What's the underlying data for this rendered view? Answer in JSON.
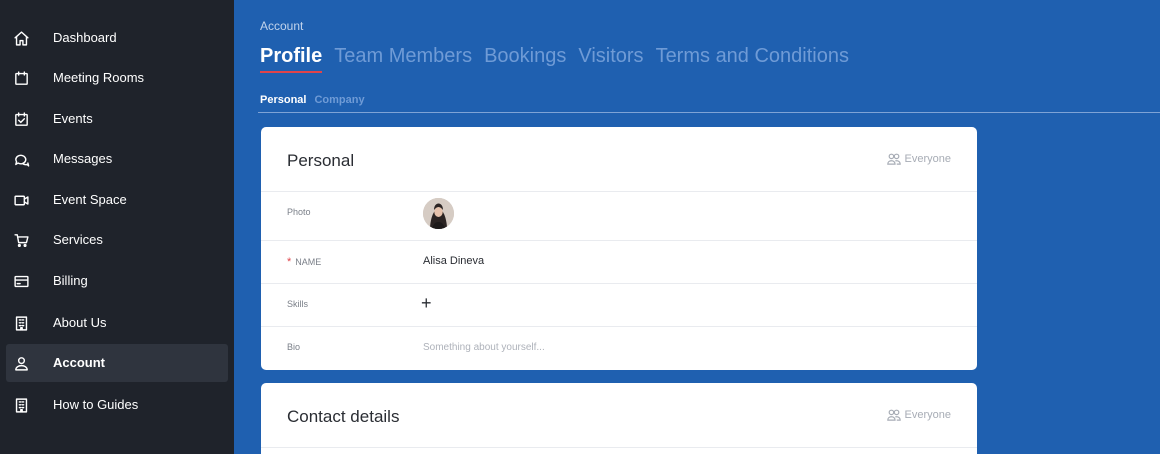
{
  "sidebar": {
    "items": [
      {
        "label": "Dashboard",
        "icon": "home-icon"
      },
      {
        "label": "Meeting Rooms",
        "icon": "calendar-icon"
      },
      {
        "label": "Events",
        "icon": "calendar-check-icon"
      },
      {
        "label": "Messages",
        "icon": "chat-icon"
      },
      {
        "label": "Event Space",
        "icon": "video-icon"
      },
      {
        "label": "Services",
        "icon": "cart-icon"
      },
      {
        "label": "Billing",
        "icon": "credit-card-icon"
      },
      {
        "label": "About Us",
        "icon": "building-icon"
      },
      {
        "label": "Account",
        "icon": "user-icon",
        "active": true
      },
      {
        "label": "How to Guides",
        "icon": "building-icon"
      }
    ]
  },
  "header": {
    "breadcrumb": "Account",
    "tabs": [
      "Profile",
      "Team Members",
      "Bookings",
      "Visitors",
      "Terms and Conditions"
    ],
    "active_tab": "Profile",
    "subtabs": [
      "Personal",
      "Company"
    ],
    "active_subtab": "Personal"
  },
  "personal_card": {
    "title": "Personal",
    "audience": "Everyone",
    "rows": {
      "photo_label": "Photo",
      "name_label": "NAME",
      "name_required_mark": "*",
      "name_value": "Alisa Dineva",
      "skills_label": "Skills",
      "skills_add": "+",
      "bio_label": "Bio",
      "bio_placeholder": "Something about yourself..."
    }
  },
  "contact_card": {
    "title": "Contact details",
    "audience": "Everyone"
  },
  "colors": {
    "sidebar_bg": "#1f232b",
    "main_bg": "#1f60b0",
    "accent_underline": "#e0444a"
  }
}
